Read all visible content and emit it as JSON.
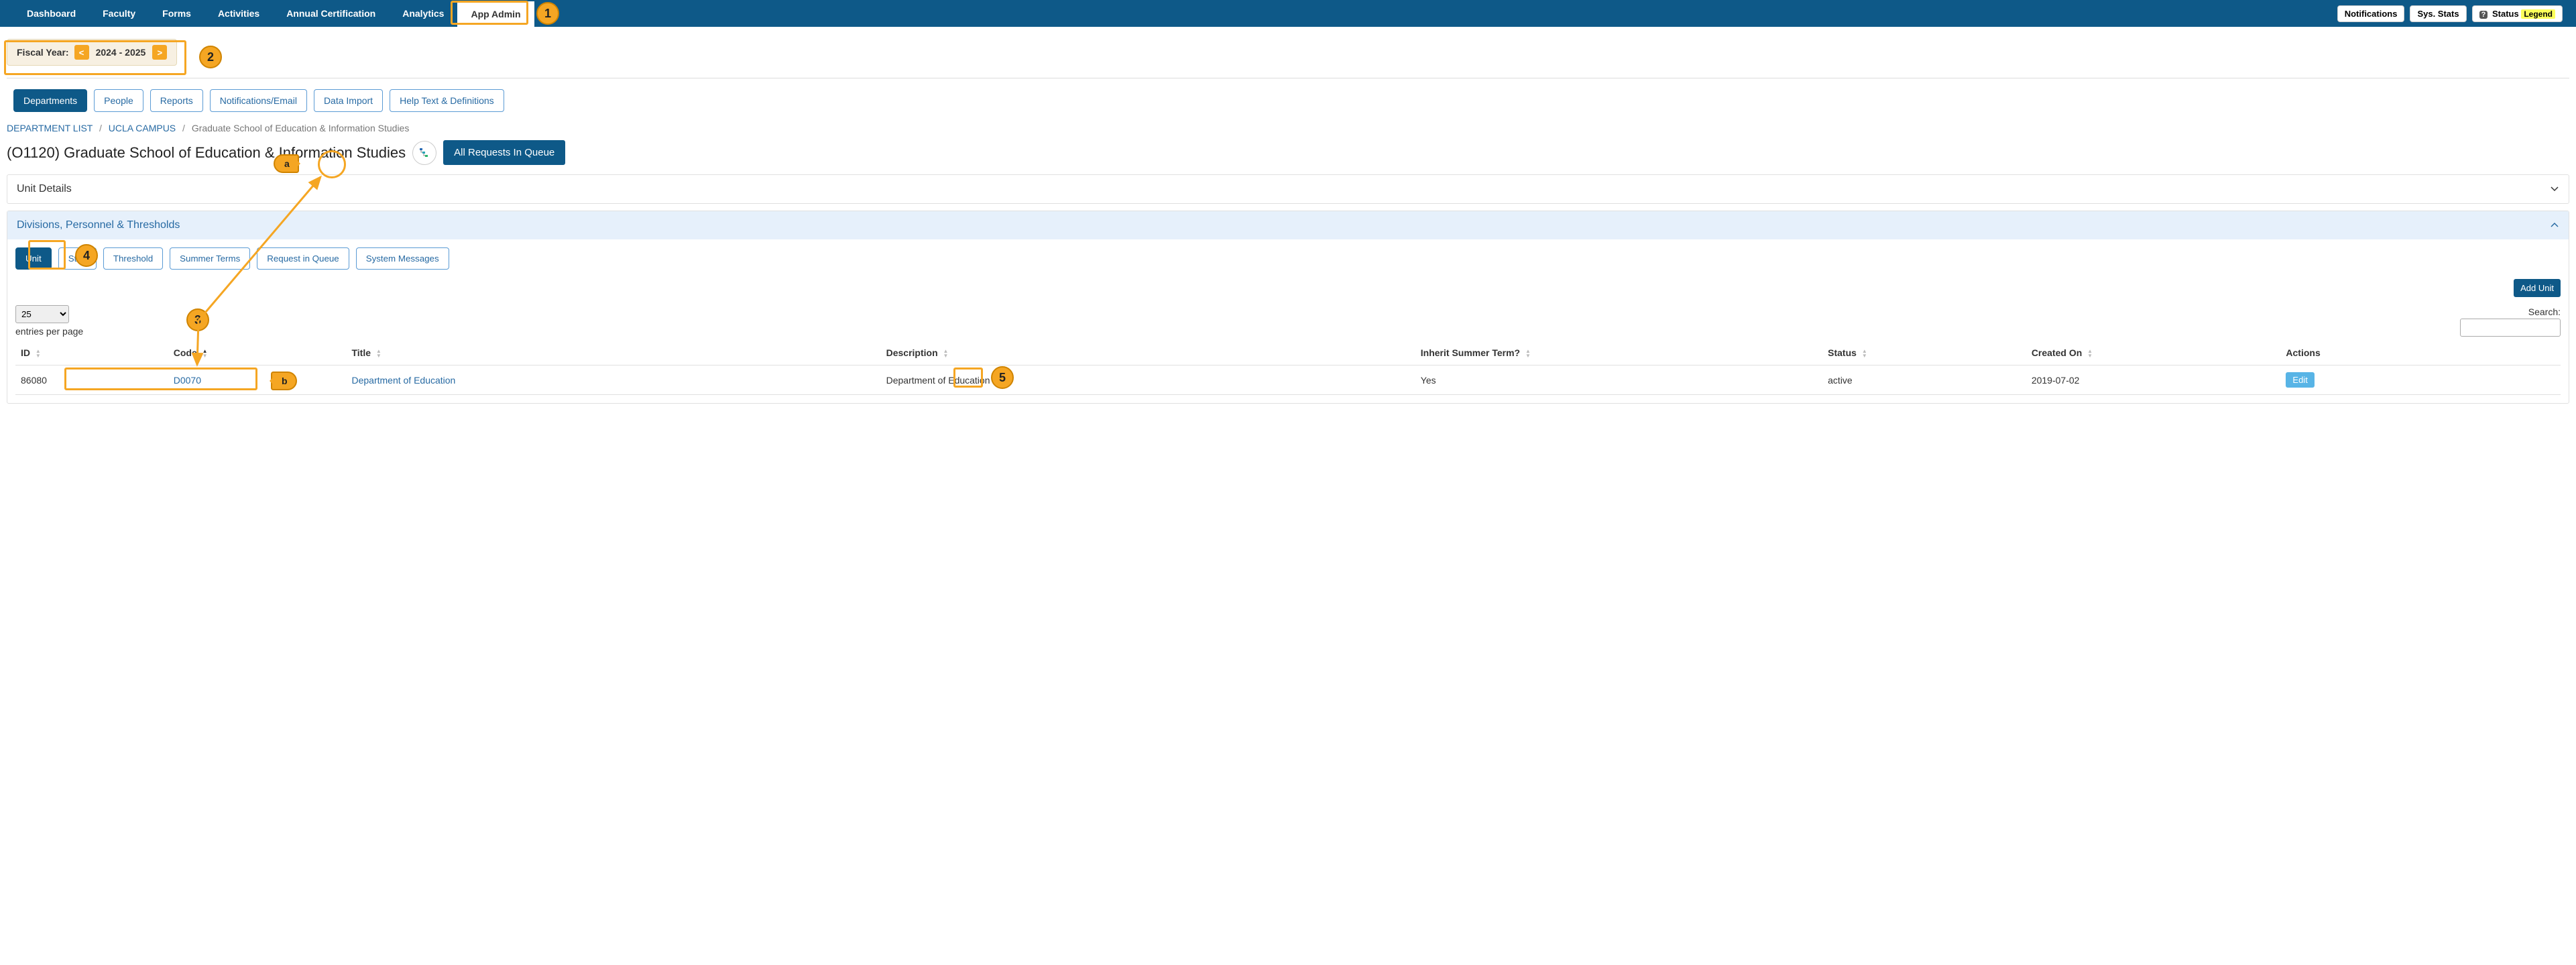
{
  "topnav": {
    "items": [
      {
        "label": "Dashboard"
      },
      {
        "label": "Faculty"
      },
      {
        "label": "Forms"
      },
      {
        "label": "Activities"
      },
      {
        "label": "Annual Certification"
      },
      {
        "label": "Analytics"
      },
      {
        "label": "App Admin",
        "active": true
      }
    ],
    "right": {
      "notifications": "Notifications",
      "sysstats": "Sys. Stats",
      "status_label": "Status",
      "legend": "Legend"
    }
  },
  "fiscal": {
    "label": "Fiscal Year:",
    "prev": "<",
    "value": "2024 - 2025",
    "next": ">"
  },
  "subtabs": [
    {
      "label": "Departments",
      "active": true
    },
    {
      "label": "People"
    },
    {
      "label": "Reports"
    },
    {
      "label": "Notifications/Email"
    },
    {
      "label": "Data Import"
    },
    {
      "label": "Help Text & Definitions"
    }
  ],
  "breadcrumb": {
    "a": "DEPARTMENT LIST",
    "b": "UCLA CAMPUS",
    "current": "Graduate School of Education & Information Studies"
  },
  "page_title": "(O1120) Graduate School of Education & Information Studies",
  "queue_btn": "All Requests In Queue",
  "panels": {
    "unit_details": "Unit Details",
    "divisions": "Divisions, Personnel & Thresholds"
  },
  "inner_tabs": [
    {
      "label": "Unit",
      "active": true
    },
    {
      "label": "Staff"
    },
    {
      "label": "Threshold"
    },
    {
      "label": "Summer Terms"
    },
    {
      "label": "Request in Queue"
    },
    {
      "label": "System Messages"
    }
  ],
  "add_unit": "Add Unit",
  "entries": {
    "selected": "25",
    "label": "entries per page"
  },
  "search_label": "Search:",
  "table": {
    "headers": {
      "id": "ID",
      "code": "Code",
      "title": "Title",
      "description": "Description",
      "inherit": "Inherit Summer Term?",
      "status": "Status",
      "created": "Created On",
      "actions": "Actions"
    },
    "rows": [
      {
        "id": "86080",
        "code": "D0070",
        "title": "Department of Education",
        "description": "Department of Education",
        "inherit": "Yes",
        "status": "active",
        "created": "2019-07-02",
        "action": "Edit"
      }
    ]
  },
  "annotations": {
    "n1": "1",
    "n2": "2",
    "n3": "3",
    "n4": "4",
    "n5": "5",
    "la": "a",
    "lb": "b"
  }
}
